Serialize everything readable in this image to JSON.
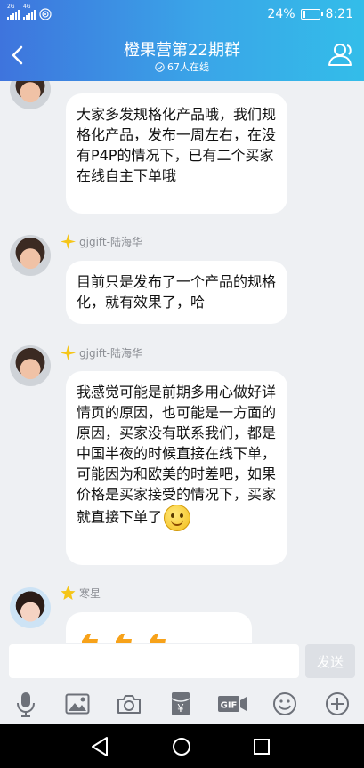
{
  "status_bar": {
    "battery": "24%",
    "battery_level": 0.24,
    "time": "8:21",
    "net1": "2G",
    "net2": "4G"
  },
  "header": {
    "title": "橙果营第22期群",
    "online_count": "67人在线"
  },
  "messages": [
    {
      "sender": "",
      "text": "大家多发规格化产品哦，我们规格化产品，发布一周左右，在没有P4P的情况下，已有二个买家在线自主下单哦"
    },
    {
      "sender": "gjgift-陆海华",
      "text": "目前只是发布了一个产品的规格化，就有效果了，哈"
    },
    {
      "sender": "gjgift-陆海华",
      "text": "我感觉可能是前期多用心做好详情页的原因，也可能是一方面的原因，买家没有联系我们，都是中国半夜的时候直接在线下单，可能因为和欧美的时差吧，如果价格是买家接受的情况下，买家就直接下单了"
    },
    {
      "sender": "寒星",
      "text": ""
    }
  ],
  "input": {
    "placeholder": "",
    "send_label": "发送"
  },
  "toolbar": {
    "gif_label": "GIF",
    "redpacket_symbol": "¥"
  },
  "colors": {
    "header_start": "#3e74dd",
    "header_end": "#33bde9",
    "bubble": "#ffffff",
    "background": "#eef0f3"
  }
}
